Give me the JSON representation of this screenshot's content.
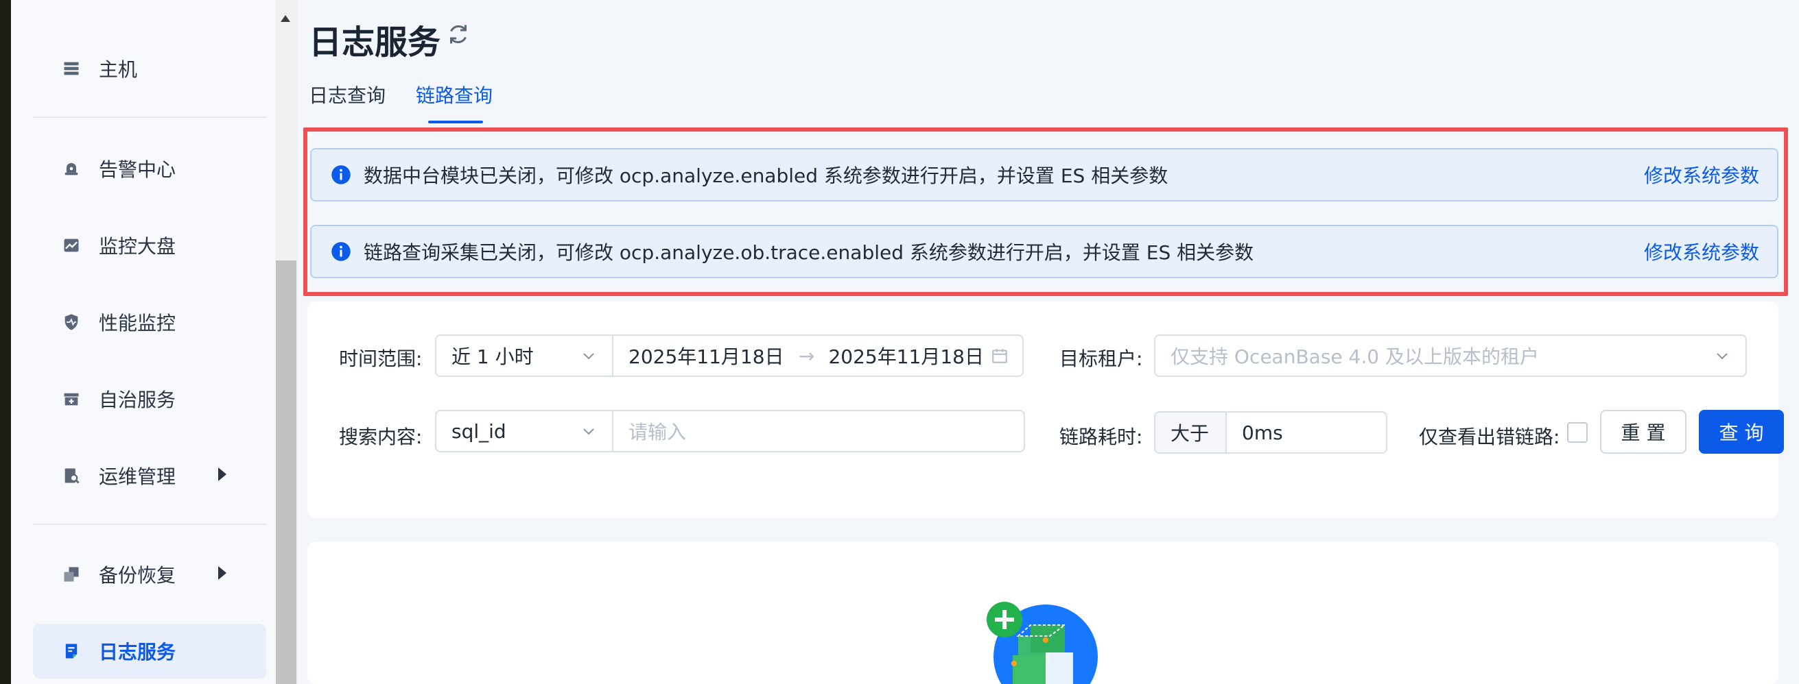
{
  "sidebar": {
    "items": [
      {
        "label": "主机",
        "icon": "server-icon"
      },
      {
        "label": "告警中心",
        "icon": "alarm-icon"
      },
      {
        "label": "监控大盘",
        "icon": "chart-icon"
      },
      {
        "label": "性能监控",
        "icon": "shield-pulse-icon"
      },
      {
        "label": "自治服务",
        "icon": "toolbox-icon"
      },
      {
        "label": "运维管理",
        "icon": "search-document-icon",
        "expandable": true
      },
      {
        "label": "备份恢复",
        "icon": "copy-icon",
        "expandable": true
      },
      {
        "label": "日志服务",
        "icon": "log-icon",
        "active": true
      }
    ]
  },
  "header": {
    "title": "日志服务",
    "tabs": [
      {
        "label": "日志查询",
        "active": false
      },
      {
        "label": "链路查询",
        "active": true
      }
    ]
  },
  "alerts": [
    {
      "message": "数据中台模块已关闭，可修改 ocp.analyze.enabled 系统参数进行开启，并设置 ES 相关参数",
      "action": "修改系统参数"
    },
    {
      "message": "链路查询采集已关闭，可修改 ocp.analyze.ob.trace.enabled 系统参数进行开启，并设置 ES 相关参数",
      "action": "修改系统参数"
    }
  ],
  "filters": {
    "time_range_label": "时间范围:",
    "time_range_value": "近 1 小时",
    "start_time": "2025年11月18日 0",
    "range_arrow": "→",
    "end_time": "2025年11月18日 1",
    "tenant_label": "目标租户:",
    "tenant_placeholder": "仅支持 OceanBase 4.0 及以上版本的租户",
    "search_label": "搜索内容:",
    "search_field": "sql_id",
    "search_placeholder": "请输入",
    "duration_label": "链路耗时:",
    "duration_op": "大于",
    "duration_value": "0ms",
    "error_only_label": "仅查看出错链路:",
    "error_only_checked": false,
    "reset_label": "重 置",
    "query_label": "查 询"
  },
  "colors": {
    "primary": "#0b5be8",
    "highlight_border": "#ef5055",
    "alert_bg": "#e8f0fc"
  }
}
